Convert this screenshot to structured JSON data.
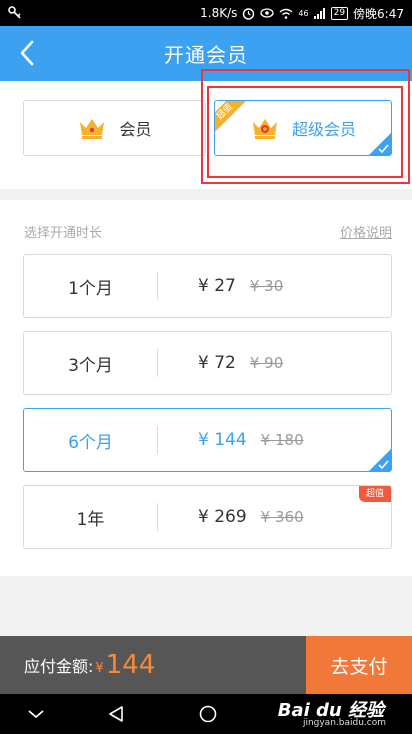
{
  "status_bar": {
    "speed": "1.8K/s",
    "signal": "46",
    "battery": "29",
    "time": "傍晚6:47"
  },
  "header": {
    "title": "开通会员"
  },
  "plans": {
    "normal_label": "会员",
    "super_label": "超级会员",
    "super_corner_tag": "超值"
  },
  "duration": {
    "section_label": "选择开通时长",
    "price_note": "价格说明",
    "options": [
      {
        "duration": "1个月",
        "price": "¥ 27",
        "original": "¥ 30"
      },
      {
        "duration": "3个月",
        "price": "¥ 72",
        "original": "¥ 90"
      },
      {
        "duration": "6个月",
        "price": "¥ 144",
        "original": "¥ 180"
      },
      {
        "duration": "1年",
        "price": "¥ 269",
        "original": "¥ 360",
        "badge": "超值"
      }
    ]
  },
  "payment": {
    "label": "应付金额:",
    "currency": "¥",
    "amount": "144",
    "button": "去支付"
  },
  "watermark": {
    "brand": "Bai du 经验",
    "url": "jingyan.baidu.com"
  },
  "colors": {
    "primary": "#3ba1f0",
    "accent": "#f2783a",
    "highlight": "#e8383d",
    "gold": "#f5b12c"
  }
}
